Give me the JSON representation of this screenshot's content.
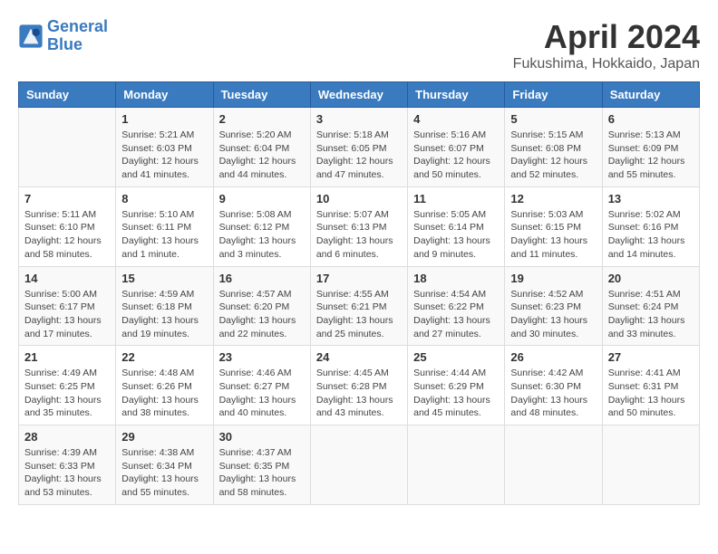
{
  "logo": {
    "line1": "General",
    "line2": "Blue"
  },
  "title": "April 2024",
  "subtitle": "Fukushima, Hokkaido, Japan",
  "header_days": [
    "Sunday",
    "Monday",
    "Tuesday",
    "Wednesday",
    "Thursday",
    "Friday",
    "Saturday"
  ],
  "weeks": [
    [
      {
        "day": "",
        "info": ""
      },
      {
        "day": "1",
        "info": "Sunrise: 5:21 AM\nSunset: 6:03 PM\nDaylight: 12 hours\nand 41 minutes."
      },
      {
        "day": "2",
        "info": "Sunrise: 5:20 AM\nSunset: 6:04 PM\nDaylight: 12 hours\nand 44 minutes."
      },
      {
        "day": "3",
        "info": "Sunrise: 5:18 AM\nSunset: 6:05 PM\nDaylight: 12 hours\nand 47 minutes."
      },
      {
        "day": "4",
        "info": "Sunrise: 5:16 AM\nSunset: 6:07 PM\nDaylight: 12 hours\nand 50 minutes."
      },
      {
        "day": "5",
        "info": "Sunrise: 5:15 AM\nSunset: 6:08 PM\nDaylight: 12 hours\nand 52 minutes."
      },
      {
        "day": "6",
        "info": "Sunrise: 5:13 AM\nSunset: 6:09 PM\nDaylight: 12 hours\nand 55 minutes."
      }
    ],
    [
      {
        "day": "7",
        "info": "Sunrise: 5:11 AM\nSunset: 6:10 PM\nDaylight: 12 hours\nand 58 minutes."
      },
      {
        "day": "8",
        "info": "Sunrise: 5:10 AM\nSunset: 6:11 PM\nDaylight: 13 hours\nand 1 minute."
      },
      {
        "day": "9",
        "info": "Sunrise: 5:08 AM\nSunset: 6:12 PM\nDaylight: 13 hours\nand 3 minutes."
      },
      {
        "day": "10",
        "info": "Sunrise: 5:07 AM\nSunset: 6:13 PM\nDaylight: 13 hours\nand 6 minutes."
      },
      {
        "day": "11",
        "info": "Sunrise: 5:05 AM\nSunset: 6:14 PM\nDaylight: 13 hours\nand 9 minutes."
      },
      {
        "day": "12",
        "info": "Sunrise: 5:03 AM\nSunset: 6:15 PM\nDaylight: 13 hours\nand 11 minutes."
      },
      {
        "day": "13",
        "info": "Sunrise: 5:02 AM\nSunset: 6:16 PM\nDaylight: 13 hours\nand 14 minutes."
      }
    ],
    [
      {
        "day": "14",
        "info": "Sunrise: 5:00 AM\nSunset: 6:17 PM\nDaylight: 13 hours\nand 17 minutes."
      },
      {
        "day": "15",
        "info": "Sunrise: 4:59 AM\nSunset: 6:18 PM\nDaylight: 13 hours\nand 19 minutes."
      },
      {
        "day": "16",
        "info": "Sunrise: 4:57 AM\nSunset: 6:20 PM\nDaylight: 13 hours\nand 22 minutes."
      },
      {
        "day": "17",
        "info": "Sunrise: 4:55 AM\nSunset: 6:21 PM\nDaylight: 13 hours\nand 25 minutes."
      },
      {
        "day": "18",
        "info": "Sunrise: 4:54 AM\nSunset: 6:22 PM\nDaylight: 13 hours\nand 27 minutes."
      },
      {
        "day": "19",
        "info": "Sunrise: 4:52 AM\nSunset: 6:23 PM\nDaylight: 13 hours\nand 30 minutes."
      },
      {
        "day": "20",
        "info": "Sunrise: 4:51 AM\nSunset: 6:24 PM\nDaylight: 13 hours\nand 33 minutes."
      }
    ],
    [
      {
        "day": "21",
        "info": "Sunrise: 4:49 AM\nSunset: 6:25 PM\nDaylight: 13 hours\nand 35 minutes."
      },
      {
        "day": "22",
        "info": "Sunrise: 4:48 AM\nSunset: 6:26 PM\nDaylight: 13 hours\nand 38 minutes."
      },
      {
        "day": "23",
        "info": "Sunrise: 4:46 AM\nSunset: 6:27 PM\nDaylight: 13 hours\nand 40 minutes."
      },
      {
        "day": "24",
        "info": "Sunrise: 4:45 AM\nSunset: 6:28 PM\nDaylight: 13 hours\nand 43 minutes."
      },
      {
        "day": "25",
        "info": "Sunrise: 4:44 AM\nSunset: 6:29 PM\nDaylight: 13 hours\nand 45 minutes."
      },
      {
        "day": "26",
        "info": "Sunrise: 4:42 AM\nSunset: 6:30 PM\nDaylight: 13 hours\nand 48 minutes."
      },
      {
        "day": "27",
        "info": "Sunrise: 4:41 AM\nSunset: 6:31 PM\nDaylight: 13 hours\nand 50 minutes."
      }
    ],
    [
      {
        "day": "28",
        "info": "Sunrise: 4:39 AM\nSunset: 6:33 PM\nDaylight: 13 hours\nand 53 minutes."
      },
      {
        "day": "29",
        "info": "Sunrise: 4:38 AM\nSunset: 6:34 PM\nDaylight: 13 hours\nand 55 minutes."
      },
      {
        "day": "30",
        "info": "Sunrise: 4:37 AM\nSunset: 6:35 PM\nDaylight: 13 hours\nand 58 minutes."
      },
      {
        "day": "",
        "info": ""
      },
      {
        "day": "",
        "info": ""
      },
      {
        "day": "",
        "info": ""
      },
      {
        "day": "",
        "info": ""
      }
    ]
  ]
}
